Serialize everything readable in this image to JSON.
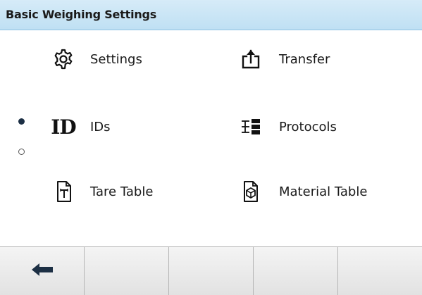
{
  "header": {
    "title": "Basic Weighing Settings"
  },
  "menu": {
    "items": [
      {
        "label": "Settings",
        "icon": "gear-icon"
      },
      {
        "label": "Transfer",
        "icon": "upload-icon"
      },
      {
        "label": "IDs",
        "icon": "id-icon",
        "glyph": "ID"
      },
      {
        "label": "Protocols",
        "icon": "protocols-icon"
      },
      {
        "label": "Tare Table",
        "icon": "tare-table-icon"
      },
      {
        "label": "Material Table",
        "icon": "material-table-icon"
      }
    ]
  },
  "pagination": {
    "current_page": 1,
    "total_pages": 2
  },
  "softkeys": [
    {
      "icon": "back-arrow-icon"
    },
    {
      "icon": ""
    },
    {
      "icon": ""
    },
    {
      "icon": ""
    },
    {
      "icon": ""
    }
  ],
  "colors": {
    "header_bg": "#c9e6f6",
    "text": "#1a1a1a",
    "active_dot": "#1c2f44",
    "softkey_bg": "#ebebeb"
  }
}
